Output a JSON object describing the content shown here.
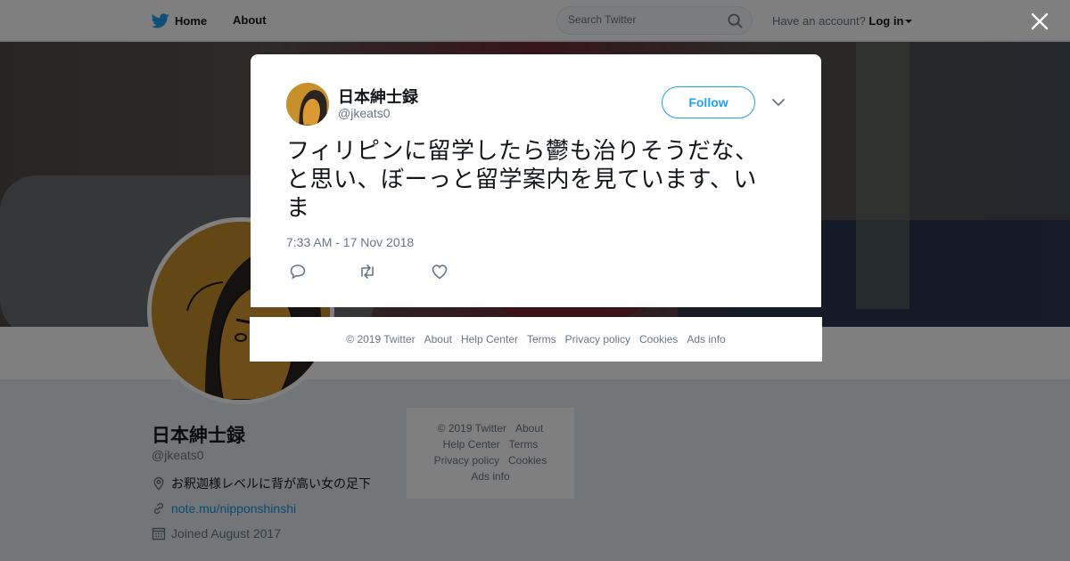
{
  "topbar": {
    "home_label": "Home",
    "about_label": "About",
    "search_placeholder": "Search Twitter",
    "have_account": "Have an account?",
    "login_label": "Log in"
  },
  "profile": {
    "name": "日本紳士録",
    "handle": "@jkeats0",
    "location": "お釈迦様レベルに背が高い女の足下",
    "url": "note.mu/nipponshinshi",
    "joined": "Joined August 2017"
  },
  "side_footer": {
    "copyright": "© 2019 Twitter",
    "about": "About",
    "help_center": "Help Center",
    "terms": "Terms",
    "privacy": "Privacy policy",
    "cookies": "Cookies",
    "ads_info": "Ads info"
  },
  "tweet": {
    "author_name": "日本紳士録",
    "author_handle": "@jkeats0",
    "follow_label": "Follow",
    "text": "フィリピンに留学したら鬱も治りそうだな、と思い、ぼーっと留学案内を見ています、いま",
    "timestamp": "7:33 AM - 17 Nov 2018"
  },
  "modal_footer": {
    "copyright": "© 2019 Twitter",
    "about": "About",
    "help_center": "Help Center",
    "terms": "Terms",
    "privacy": "Privacy policy",
    "cookies": "Cookies",
    "ads_info": "Ads info"
  },
  "icons": {
    "brand": "twitter-bird-icon",
    "search": "search-icon",
    "close": "close-icon",
    "chevron": "chevron-down-icon",
    "reply": "reply-icon",
    "retweet": "retweet-icon",
    "like": "heart-icon",
    "location": "location-pin-icon",
    "link": "link-icon",
    "calendar": "calendar-icon"
  },
  "colors": {
    "brand_blue": "#1da1f2",
    "link_blue": "#1b95e0",
    "text": "#14171a",
    "secondary_text": "#657786",
    "overlay": "rgba(0,0,0,0.5)"
  }
}
